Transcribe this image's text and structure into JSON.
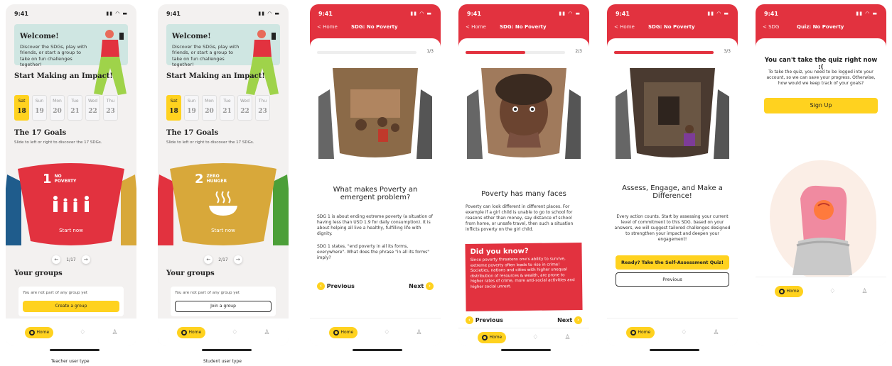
{
  "status_time": "9:41",
  "tabbar": {
    "home_label": "Home"
  },
  "captions": {
    "teacher": "Teacher user type",
    "student": "Student  user type"
  },
  "home": {
    "welcome_title": "Welcome!",
    "welcome_text": "Discover the SDGs, play with friends, or start a group to take on fun challenges together!",
    "impact_title": "Start Making an Impact!",
    "days": [
      {
        "dow": "Sat",
        "num": "18"
      },
      {
        "dow": "Sun",
        "num": "19"
      },
      {
        "dow": "Mon",
        "num": "20"
      },
      {
        "dow": "Tue",
        "num": "21"
      },
      {
        "dow": "Wed",
        "num": "22"
      },
      {
        "dow": "Thu",
        "num": "23"
      }
    ],
    "goals_title": "The 17 Goals",
    "goals_sub": "Slide to left or right to discover the 17 SDGs.",
    "start_now": "Start now",
    "groups_title": "Your groups",
    "groups_msg": "You are not part of any group yet"
  },
  "teacher": {
    "goal_number": "1",
    "goal_name": "NO POVERTY",
    "pager": "1/17",
    "group_button": "Create a group",
    "goal_color": "#e2323f"
  },
  "student": {
    "goal_number": "2",
    "goal_name": "ZERO HUNGER",
    "pager": "2/17",
    "group_button": "Join a group",
    "goal_color": "#d8a83a"
  },
  "lesson": {
    "back_label": "< Home",
    "header_title": "SDG: No Poverty",
    "previous": "Previous",
    "next": "Next",
    "s1": {
      "count": "1/3",
      "progress": 0.0,
      "title": "What makes Poverty an emergent problem?",
      "p1": "SDG 1 is about ending extreme poverty (a situation of having less than USD 1.9 for daily consumption). It is about helping all live a healthy, fulfilling life with dignity.",
      "p2": "SDG 1 states, \"end poverty in all its forms, everywhere\". What does the phrase \"in all its forms\" imply?"
    },
    "s2": {
      "count": "2/3",
      "progress": 0.6,
      "title": "Poverty has many faces",
      "p1": "Poverty can look different in different places. For example if a girl child is unable to go to school for reasons other than money, say distance of school from home, or unsafe travel, then such a situation inflicts poverty on the girl child.",
      "know_title": "Did you know?",
      "know_text": "Since poverty threatens one's ability to survive, extreme poverty often leads to rise in crime! Societies, nations and cities with higher unequal distribution of resources & wealth, are prone to higher rates of crime, more anti-social activities and higher social unrest."
    },
    "s3": {
      "count": "3/3",
      "progress": 1.0,
      "title": "Assess, Engage, and Make a Difference!",
      "p1": "Every action counts. Start by assessing your current level of commitment to this SDG. based on your answers, we will suggest tailored challenges designed to strengthen your impact and deepen your engagement!",
      "quiz_button": "Ready? Take the Self-Assessment Quiz!",
      "previous_button": "Previous"
    }
  },
  "quiz": {
    "back_label": "< SDG",
    "header_title": "Quiz: No Poverty",
    "title": "You can't take the quiz right now :(",
    "text": "To take the quiz, you need to be logged into your account, so we can save your progress. Otherwise, how would we keep track of your goals?",
    "signup": "Sign Up"
  },
  "colors": {
    "red": "#e2323f",
    "yellow": "#ffd21f",
    "teal_bg": "#cfe6e2"
  }
}
